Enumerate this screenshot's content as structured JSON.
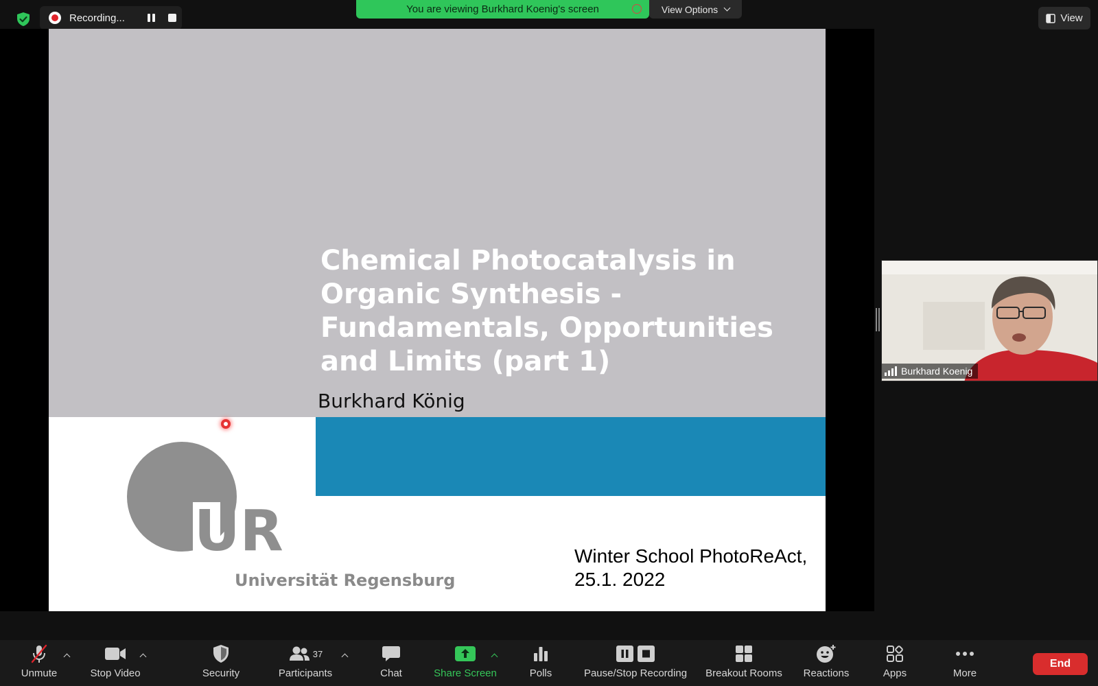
{
  "recording": {
    "label": "Recording..."
  },
  "banner": {
    "text": "You are viewing Burkhard Koenig's screen",
    "view_options": "View Options"
  },
  "view_button": {
    "label": "View"
  },
  "slide": {
    "title_lines": [
      "Chemical Photocatalysis in",
      "Organic Synthesis -",
      "Fundamentals, Opportunities",
      "and Limits (part 1)"
    ],
    "author": "Burkhard König",
    "logo_text": "UR",
    "university": "Universität Regensburg",
    "event_lines": [
      "Winter School PhotoReAct,",
      "25.1. 2022"
    ],
    "colors": {
      "top_panel": "#c2c0c4",
      "band": "#1a88b6"
    }
  },
  "participant_video": {
    "name": "Burkhard Koenig"
  },
  "toolbar": {
    "unmute": "Unmute",
    "stop_video": "Stop Video",
    "security": "Security",
    "participants": "Participants",
    "participants_count": "37",
    "chat": "Chat",
    "share_screen": "Share Screen",
    "polls": "Polls",
    "pause_stop_recording": "Pause/Stop Recording",
    "breakout_rooms": "Breakout Rooms",
    "reactions": "Reactions",
    "apps": "Apps",
    "more": "More",
    "end": "End"
  },
  "colors": {
    "accent_green": "#2fc65a",
    "end_red": "#d92d2d",
    "record_red": "#e0242b"
  }
}
